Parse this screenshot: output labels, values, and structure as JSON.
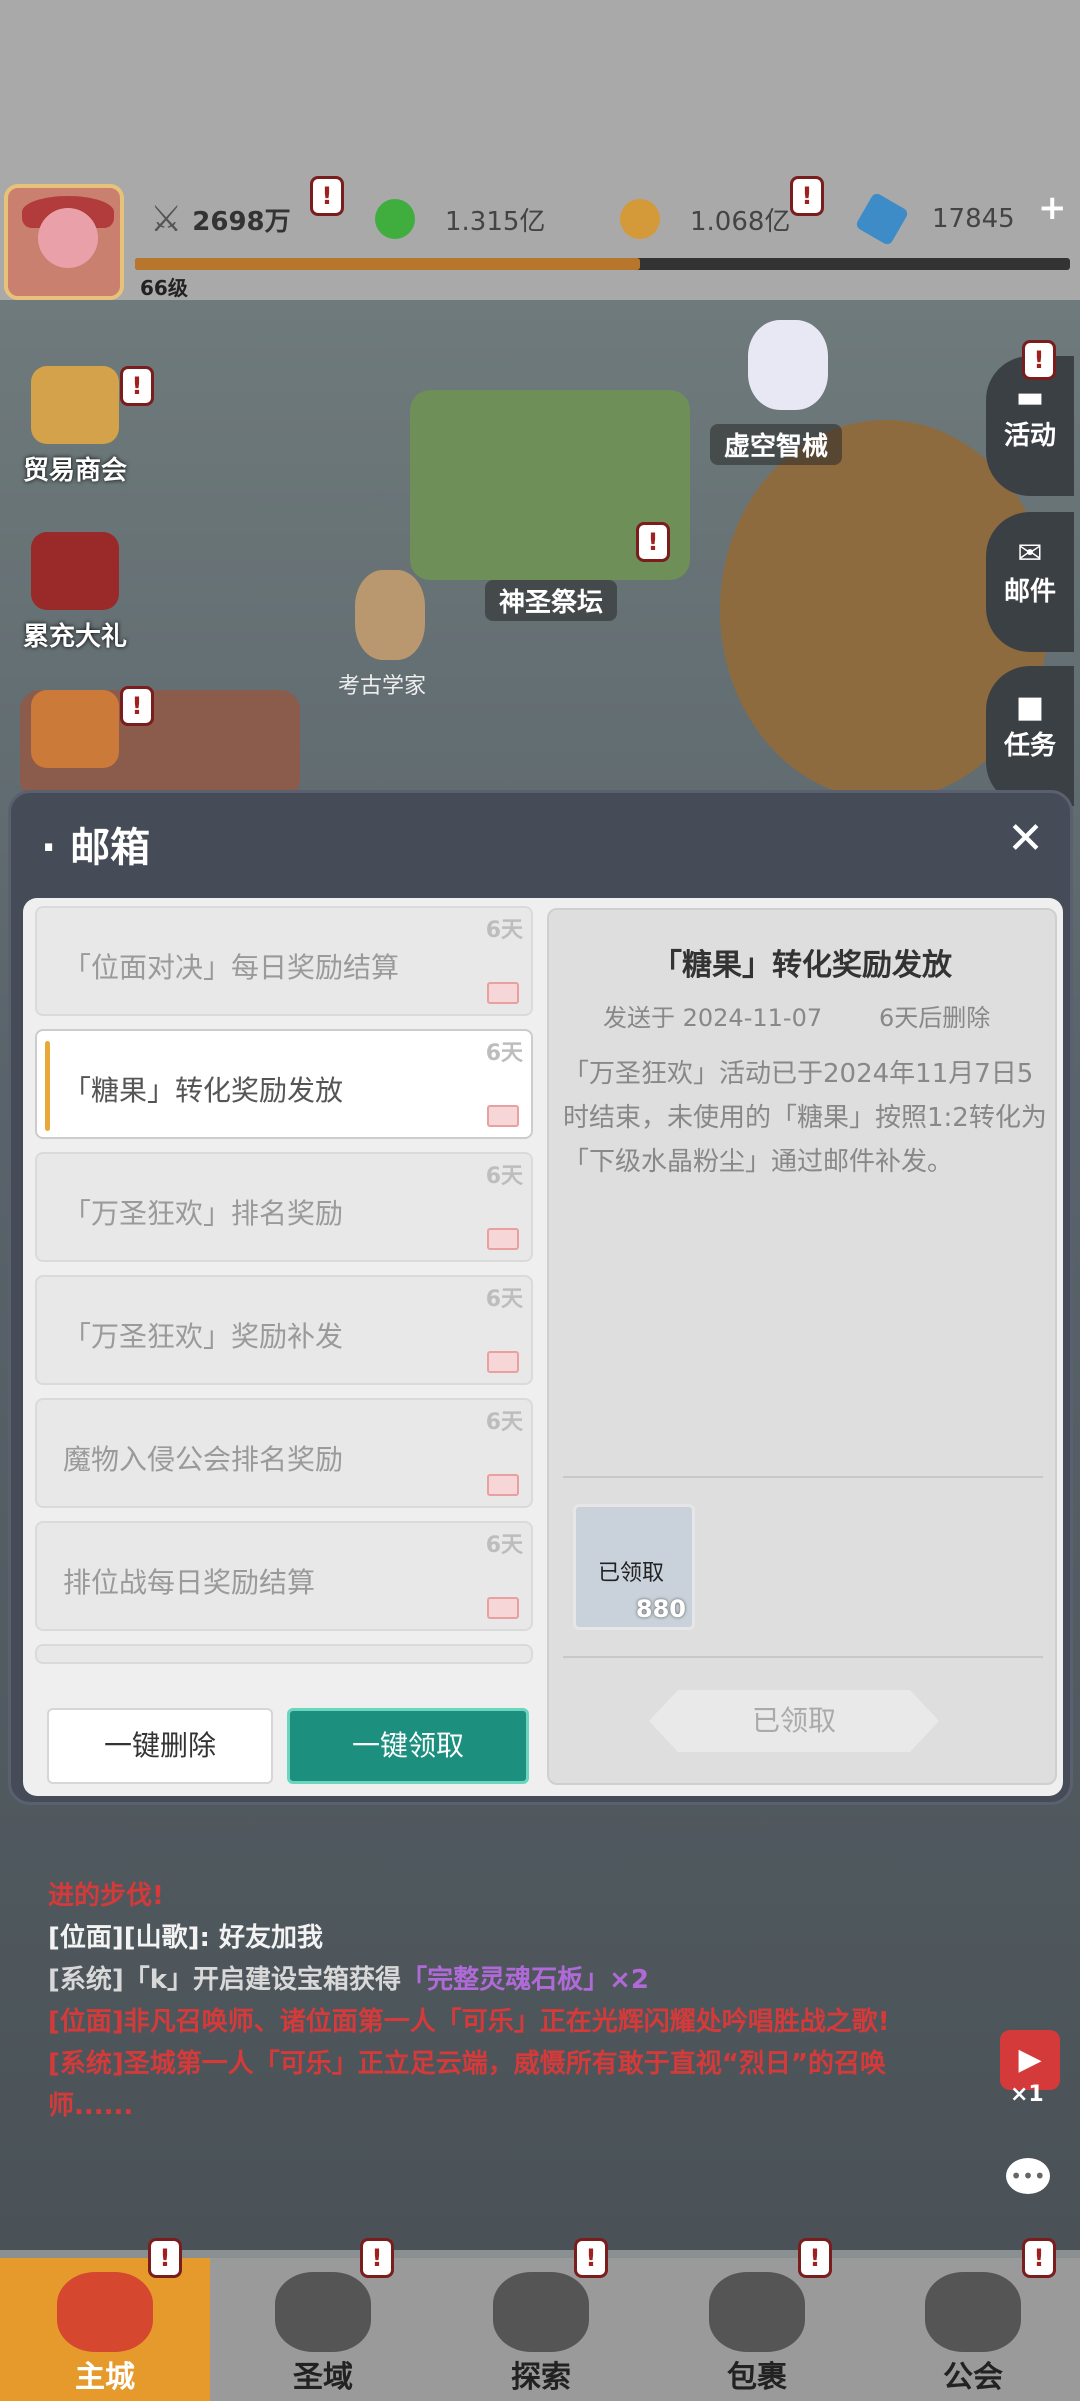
{
  "player": {
    "level": "66级",
    "power": "2698万"
  },
  "resources": [
    {
      "name": "green-gem",
      "value": "1.315亿",
      "color": "#3fae3f"
    },
    {
      "name": "gold-coin",
      "value": "1.068亿",
      "color": "#d49a3a"
    },
    {
      "name": "crystal",
      "value": "17845",
      "color": "#3d8cc8"
    }
  ],
  "map": {
    "left_buttons": [
      "贸易商会",
      "累充大礼"
    ],
    "labels": {
      "void_machine": "虚空智械",
      "altar": "神圣祭坛",
      "archaeologist": "考古学家"
    },
    "right_buttons": [
      "活动",
      "邮件",
      "任务"
    ]
  },
  "mailbox": {
    "title": "邮箱",
    "items": [
      {
        "title": "「位面对决」每日奖励结算",
        "days": "6天",
        "active": false
      },
      {
        "title": "「糖果」转化奖励发放",
        "days": "6天",
        "active": true
      },
      {
        "title": "「万圣狂欢」排名奖励",
        "days": "6天",
        "active": false
      },
      {
        "title": "「万圣狂欢」奖励补发",
        "days": "6天",
        "active": false
      },
      {
        "title": "魔物入侵公会排名奖励",
        "days": "6天",
        "active": false
      },
      {
        "title": "排位战每日奖励结算",
        "days": "6天",
        "active": false
      }
    ],
    "delete_all": "一键删除",
    "claim_all": "一键领取",
    "detail": {
      "title": "「糖果」转化奖励发放",
      "sent": "发送于 2024-11-07",
      "delete_in": "6天后删除",
      "body": "「万圣狂欢」活动已于2024年11月7日5时结束，未使用的「糖果」按照1:2转化为「下级水晶粉尘」通过邮件补发。",
      "reward_status": "已领取",
      "reward_count": "880",
      "claimed_button": "已领取"
    }
  },
  "chat": {
    "line1": "进的步伐!",
    "line2a": "[位面][山歌]: ",
    "line2b": "好友加我",
    "line3a": "[系统]「k」开启建设宝箱获得",
    "line3b": "「完整灵魂石板」",
    "line3c": "×2",
    "line4": "[位面]非凡召唤师、诸位面第一人「可乐」正在光辉闪耀处吟唱胜战之歌!",
    "line5": "[系统]圣城第一人「可乐」正立足云端，威慑所有敢于直视“烈日”的召唤师......"
  },
  "side_right": {
    "video_count": "×1"
  },
  "nav": [
    "主城",
    "圣域",
    "探索",
    "包裹",
    "公会"
  ]
}
